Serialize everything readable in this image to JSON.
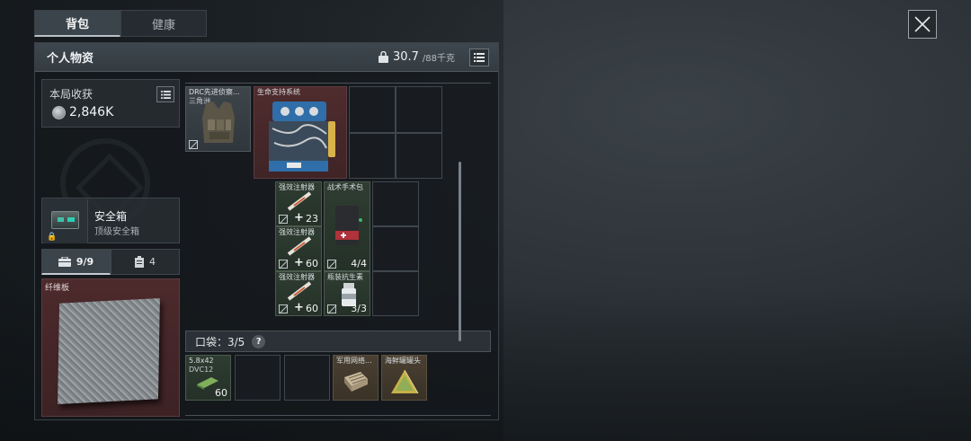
{
  "top_tabs": [
    "背包",
    "健康"
  ],
  "panel": {
    "title": "个人物资",
    "weight_current": "30.7",
    "weight_max": "/88千克"
  },
  "earnings": {
    "label": "本局收获",
    "value": "2,846K"
  },
  "safe_box": {
    "title": "安全箱",
    "subtitle": "顶级安全箱"
  },
  "sub_tabs": [
    {
      "label": "9/9",
      "icon": "backpack-icon"
    },
    {
      "label": "4",
      "icon": "clipboard-icon"
    }
  ],
  "armor_slot": {
    "label": "纤维板"
  },
  "items": {
    "vest": {
      "name_line1": "DRC先进侦察...",
      "name_line2": "三角洲"
    },
    "life_support": {
      "name": "生命支持系统"
    },
    "injector_1": {
      "name": "强效注射器",
      "count": "23"
    },
    "injector_2": {
      "name": "强效注射器",
      "count": "60"
    },
    "injector_3": {
      "name": "强效注射器",
      "count": "60"
    },
    "surgery_kit": {
      "name": "战术手术包",
      "count": "4/4"
    },
    "antibiotic": {
      "name": "瓶装抗生素",
      "count": "3/3"
    },
    "ammo": {
      "name_line1": "5.8x42",
      "name_line2": "DVC12",
      "count": "60"
    },
    "military_net": {
      "name": "军用网络..."
    },
    "seafood_can": {
      "name": "海鲜罐罐头"
    }
  },
  "pocket": {
    "label": "口袋：3/5",
    "help": "?"
  },
  "colors": {
    "rare_red": "#4f2c2e",
    "item_gray": "#3d454b",
    "accent_teal": "#2ad0b2"
  }
}
